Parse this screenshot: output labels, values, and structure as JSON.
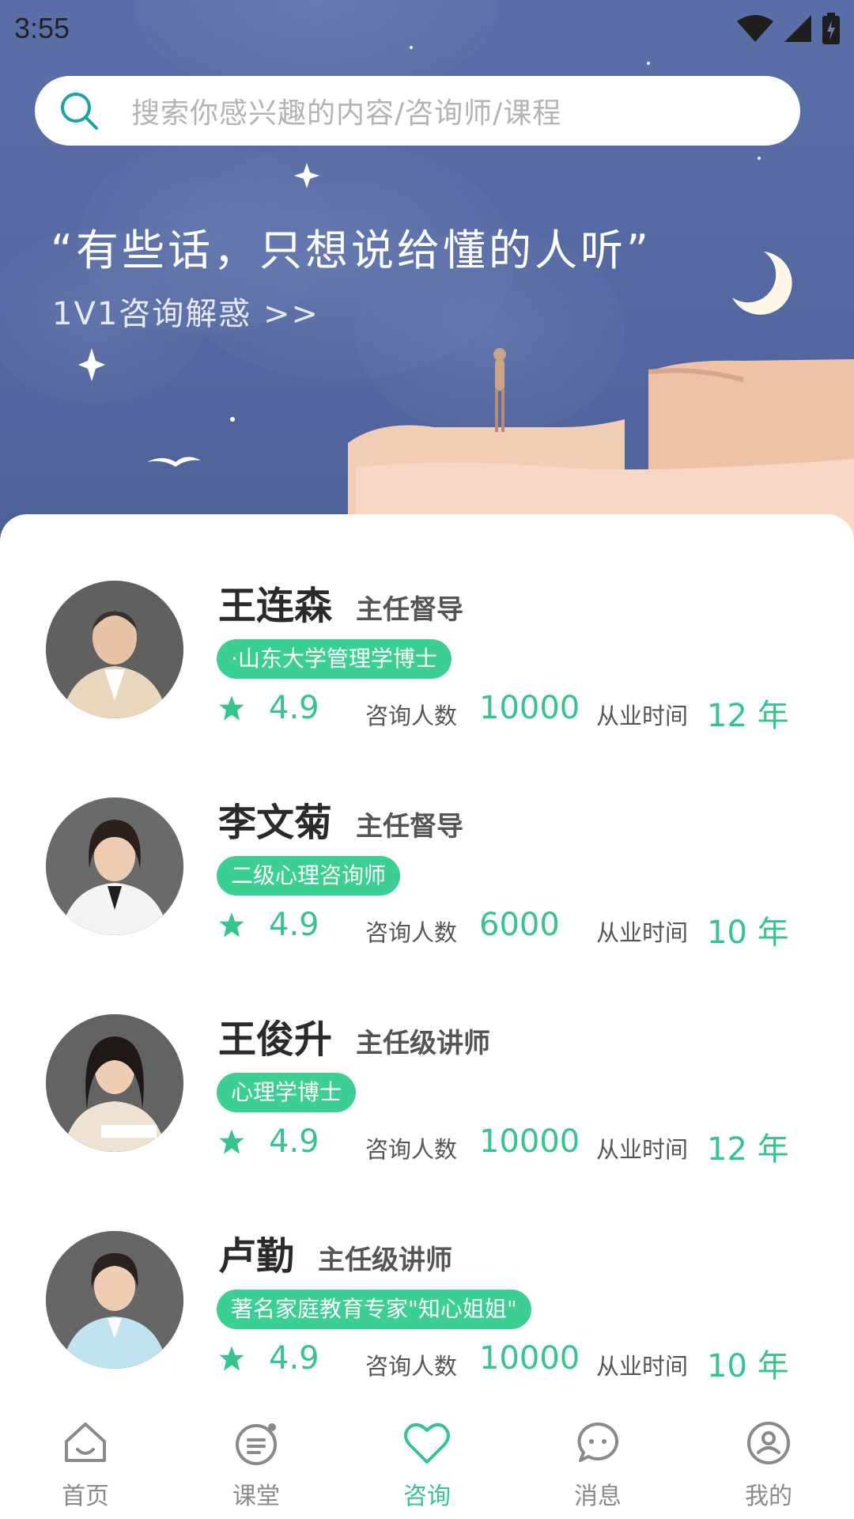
{
  "status_bar": {
    "time": "3:55"
  },
  "search": {
    "placeholder": "搜索你感兴趣的内容/咨询师/课程"
  },
  "banner": {
    "quote": "“有些话，只想说给懂的人听”",
    "subtitle": "1V1咨询解惑 >>"
  },
  "colors": {
    "accent": "#36c48c",
    "tag_bg": "#3ccf93",
    "banner_bg": "#5669a3"
  },
  "counselors": [
    {
      "name": "王连森",
      "title": "主任督导",
      "tag": "·山东大学管理学博士",
      "rating": "4.9",
      "consult_label": "咨询人数",
      "consult_count": "10000",
      "years_label": "从业时间",
      "years": "12 年"
    },
    {
      "name": "李文菊",
      "title": "主任督导",
      "tag": "二级心理咨询师",
      "rating": "4.9",
      "consult_label": "咨询人数",
      "consult_count": "6000",
      "years_label": "从业时间",
      "years": "10 年"
    },
    {
      "name": "王俊升",
      "title": "主任级讲师",
      "tag": "心理学博士",
      "rating": "4.9",
      "consult_label": "咨询人数",
      "consult_count": "10000",
      "years_label": "从业时间",
      "years": "12 年"
    },
    {
      "name": "卢勤",
      "title": "主任级讲师",
      "tag": "著名家庭教育专家\"知心姐姐\"",
      "rating": "4.9",
      "consult_label": "咨询人数",
      "consult_count": "10000",
      "years_label": "从业时间",
      "years": "10 年"
    }
  ],
  "bottom_nav": {
    "items": [
      {
        "label": "首页",
        "icon": "home-icon",
        "active": false
      },
      {
        "label": "课堂",
        "icon": "classroom-icon",
        "active": false
      },
      {
        "label": "咨询",
        "icon": "heart-icon",
        "active": true
      },
      {
        "label": "消息",
        "icon": "message-icon",
        "active": false
      },
      {
        "label": "我的",
        "icon": "profile-icon",
        "active": false
      }
    ]
  }
}
